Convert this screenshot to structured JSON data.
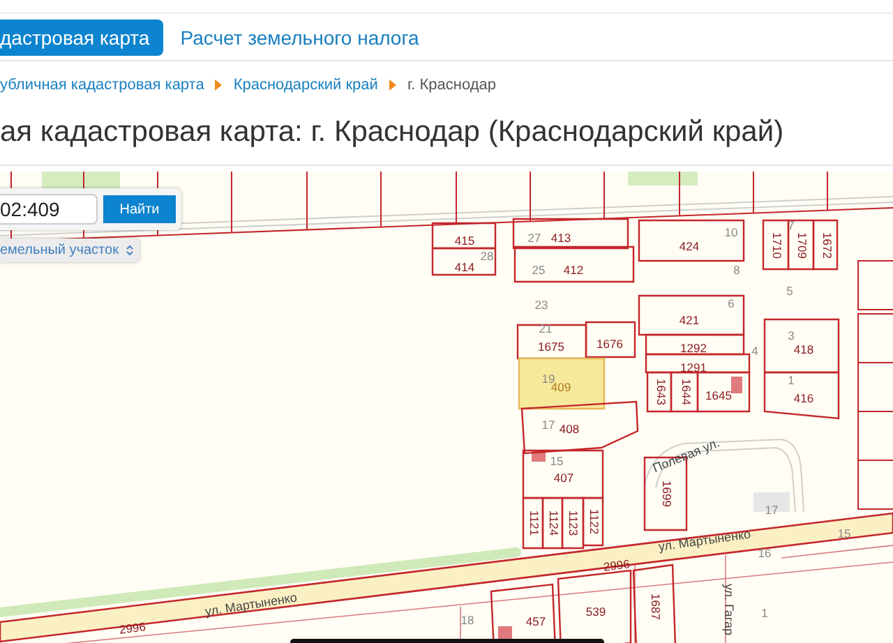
{
  "tabs": [
    {
      "label": "дастровая карта",
      "selected": true
    },
    {
      "label": "Расчет земельного налога",
      "selected": false
    }
  ],
  "breadcrumbs": [
    {
      "label": "убличная кадастровая карта",
      "link": true
    },
    {
      "label": "Краснодарский край",
      "link": true
    },
    {
      "label": "г. Краснодар",
      "link": false
    }
  ],
  "title": "ая кадастровая карта: г. Краснодар (Краснодарский край)",
  "search": {
    "value": "02:409",
    "button": "Найти",
    "object_type": "емельный участок"
  },
  "map": {
    "parcels": [
      {
        "number": "415",
        "selected": false
      },
      {
        "number": "414",
        "selected": false
      },
      {
        "number": "413",
        "selected": false
      },
      {
        "number": "412",
        "selected": false
      },
      {
        "number": "424",
        "selected": false
      },
      {
        "number": "1710",
        "selected": false
      },
      {
        "number": "1709",
        "selected": false
      },
      {
        "number": "1672",
        "selected": false
      },
      {
        "number": "421",
        "selected": false
      },
      {
        "number": "1292",
        "selected": false
      },
      {
        "number": "1291",
        "selected": false
      },
      {
        "number": "1643",
        "selected": false
      },
      {
        "number": "1644",
        "selected": false
      },
      {
        "number": "1645",
        "selected": false
      },
      {
        "number": "1675",
        "selected": false
      },
      {
        "number": "1676",
        "selected": false
      },
      {
        "number": "409",
        "selected": true
      },
      {
        "number": "408",
        "selected": false
      },
      {
        "number": "418",
        "selected": false
      },
      {
        "number": "416",
        "selected": false
      },
      {
        "number": "407",
        "selected": false
      },
      {
        "number": "1121",
        "selected": false
      },
      {
        "number": "1124",
        "selected": false
      },
      {
        "number": "1123",
        "selected": false
      },
      {
        "number": "1122",
        "selected": false
      },
      {
        "number": "1699",
        "selected": false
      },
      {
        "number": "539",
        "selected": false
      },
      {
        "number": "1687",
        "selected": false
      },
      {
        "number": "457",
        "selected": false
      }
    ],
    "house_numbers": [
      "27",
      "28",
      "25",
      "23",
      "21",
      "19",
      "17",
      "15",
      "10",
      "8",
      "7",
      "5",
      "6",
      "4",
      "3",
      "1",
      "17",
      "16",
      "15",
      "18",
      "1"
    ],
    "road_numbers": [
      "2996",
      "2996"
    ],
    "streets": [
      "Полевая ул.",
      "ул. Мартыненко",
      "ул. Мартыненко",
      "ул. Гагар"
    ]
  }
}
